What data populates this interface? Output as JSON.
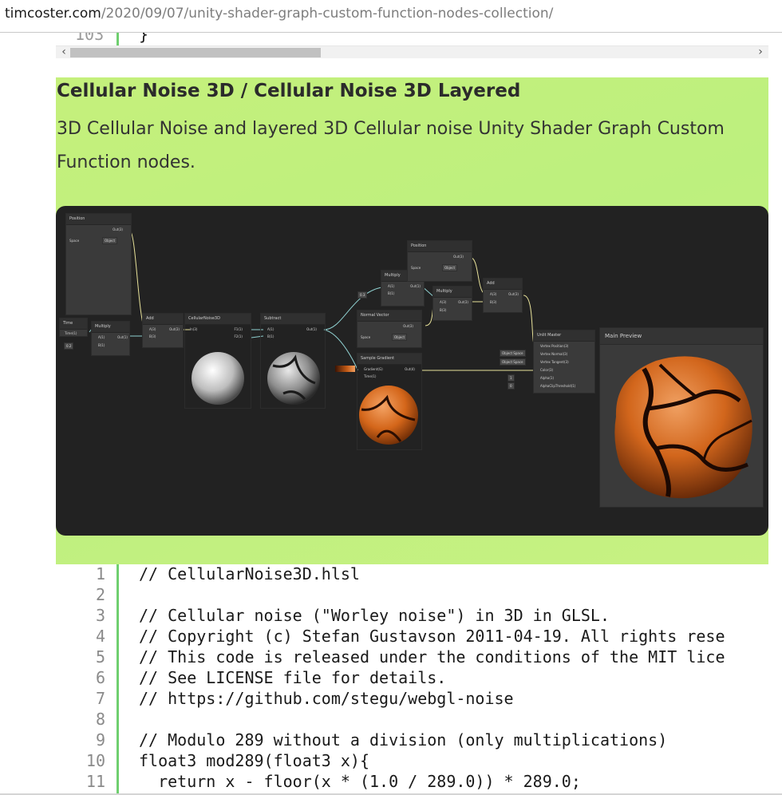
{
  "browser": {
    "url_host": "timcoster.com",
    "url_path": "/2020/09/07/unity-shader-graph-custom-function-nodes-collection/"
  },
  "top_code": {
    "line_number": "103",
    "text": "}"
  },
  "scrollbar": {
    "left_arrow": "‹",
    "right_arrow": "›"
  },
  "section": {
    "title": "Cellular Noise 3D / Cellular Noise 3D Layered",
    "description": "3D Cellular Noise and layered 3D Cellular noise Unity Shader Graph Custom Function nodes."
  },
  "graph": {
    "nodes": {
      "position1": {
        "title": "Position",
        "out": "Out(3)",
        "space_label": "Space",
        "space_value": "Object"
      },
      "time": {
        "title": "Time",
        "out": "Time(1)",
        "value": "0.2"
      },
      "multiply1": {
        "title": "Multiply",
        "a": "A(1)",
        "b": "B(1)",
        "out": "Out(1)"
      },
      "add1": {
        "title": "Add",
        "a": "A(3)",
        "b": "B(3)",
        "out": "Out(3)"
      },
      "cellular": {
        "title": "CellularNoise3D",
        "in": "In(3)",
        "f1": "F1(1)",
        "f2": "F2(1)"
      },
      "subtract": {
        "title": "Subtract",
        "a": "A(1)",
        "b": "B(1)",
        "out": "Out(1)"
      },
      "multiply2": {
        "title": "Multiply",
        "a": "A(1)",
        "b": "B(1)",
        "out": "Out(1)",
        "value": "0.3"
      },
      "position2": {
        "title": "Position",
        "out": "Out(3)",
        "space_label": "Space",
        "space_value": "Object"
      },
      "multiply3": {
        "title": "Multiply",
        "a": "A(3)",
        "b": "B(3)",
        "out": "Out(3)"
      },
      "add2": {
        "title": "Add",
        "a": "A(3)",
        "b": "B(3)",
        "out": "Out(3)"
      },
      "normal": {
        "title": "Normal Vector",
        "out": "Out(3)",
        "space_label": "Space",
        "space_value": "Object"
      },
      "gradient": {
        "title": "Sample Gradient",
        "gradient": "Gradient(G)",
        "time": "Time(1)",
        "out": "Out(4)"
      },
      "master": {
        "title": "Unlit Master",
        "ports": [
          "Vertex Position(3)",
          "Vertex Normal(3)",
          "Vertex Tangent(3)",
          "Color(3)",
          "Alpha(1)",
          "AlphaClipThreshold(1)"
        ],
        "inputs": [
          "Object Space",
          "Object Space",
          "1",
          "0"
        ]
      }
    },
    "main_preview_title": "Main Preview"
  },
  "code": {
    "lines": [
      {
        "n": "1",
        "t": "// CellularNoise3D.hlsl"
      },
      {
        "n": "2",
        "t": ""
      },
      {
        "n": "3",
        "t": "// Cellular noise (\"Worley noise\") in 3D in GLSL."
      },
      {
        "n": "4",
        "t": "// Copyright (c) Stefan Gustavson 2011-04-19. All rights rese"
      },
      {
        "n": "5",
        "t": "// This code is released under the conditions of the MIT lice"
      },
      {
        "n": "6",
        "t": "// See LICENSE file for details."
      },
      {
        "n": "7",
        "t": "// https://github.com/stegu/webgl-noise"
      },
      {
        "n": "8",
        "t": ""
      },
      {
        "n": "9",
        "t": "// Modulo 289 without a division (only multiplications)"
      },
      {
        "n": "10",
        "t": "float3 mod289(float3 x){"
      },
      {
        "n": "11",
        "t": "  return x - floor(x * (1.0 / 289.0)) * 289.0;"
      }
    ]
  },
  "colors": {
    "highlight_green": "#c2f07e",
    "gutter_green": "#6fcf6f",
    "graph_bg": "#222222",
    "wire": "#8fd0d0"
  }
}
